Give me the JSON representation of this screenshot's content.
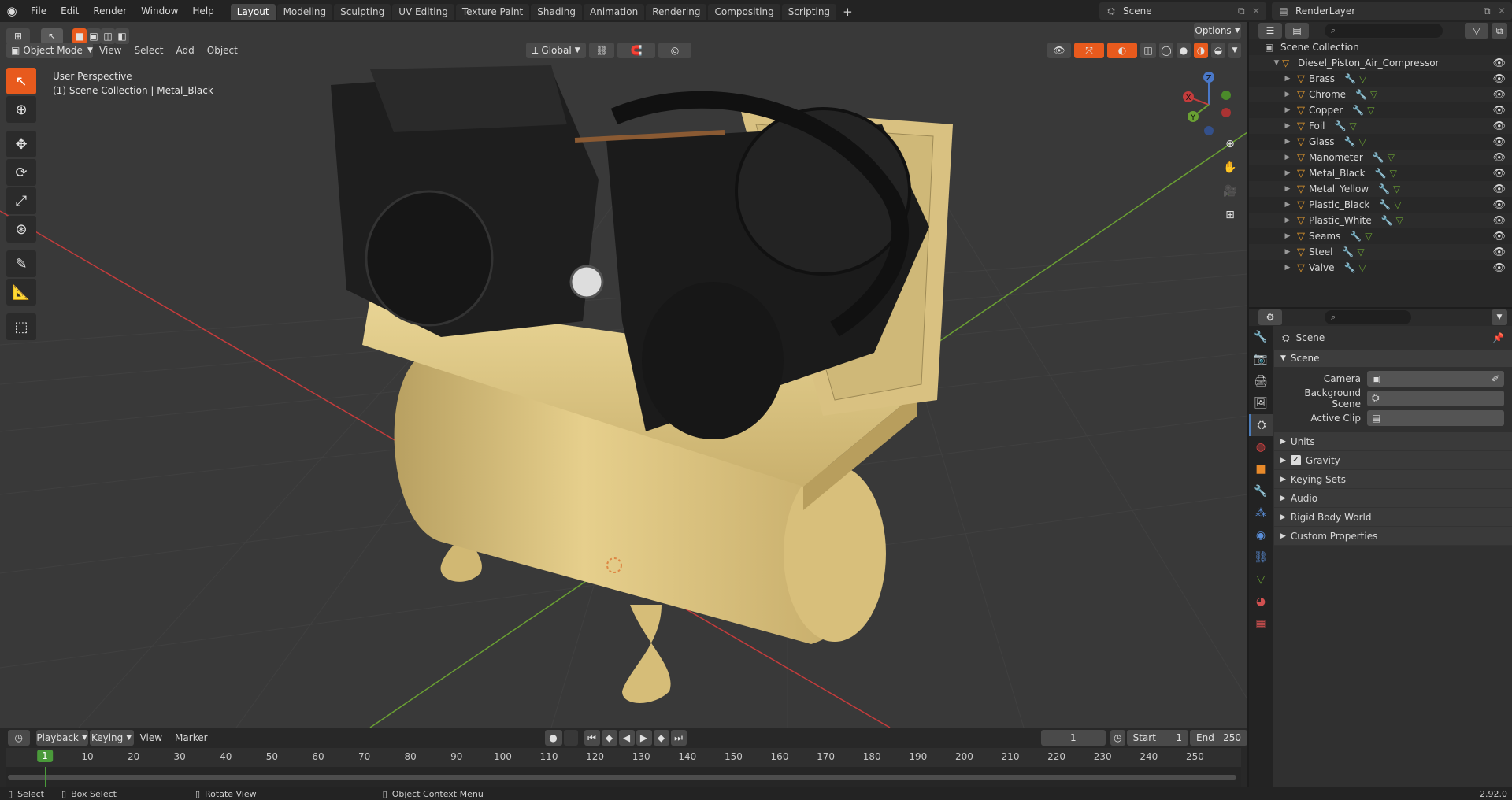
{
  "app": {
    "logo": "blender-icon"
  },
  "menu": [
    "File",
    "Edit",
    "Render",
    "Window",
    "Help"
  ],
  "workspaces": [
    {
      "label": "Layout",
      "active": true
    },
    {
      "label": "Modeling"
    },
    {
      "label": "Sculpting"
    },
    {
      "label": "UV Editing"
    },
    {
      "label": "Texture Paint"
    },
    {
      "label": "Shading"
    },
    {
      "label": "Animation"
    },
    {
      "label": "Rendering"
    },
    {
      "label": "Compositing"
    },
    {
      "label": "Scripting"
    }
  ],
  "workspace_add": "+",
  "scene_selector": {
    "value": "Scene"
  },
  "renderlayer_selector": {
    "value": "RenderLayer"
  },
  "viewport": {
    "mode": "Object Mode",
    "menus": [
      "View",
      "Select",
      "Add",
      "Object"
    ],
    "transform": "Global",
    "options_label": "Options",
    "perspective": "User Perspective",
    "collection_info": "(1) Scene Collection | Metal_Black",
    "gizmo_axes": {
      "x": "X",
      "y": "Y",
      "z": "Z"
    }
  },
  "timeline": {
    "menus": [
      "Playback",
      "Keying",
      "View",
      "Marker"
    ],
    "current_frame": "1",
    "start_label": "Start",
    "start": "1",
    "end_label": "End",
    "end": "250",
    "ruler": [
      "10",
      "20",
      "30",
      "40",
      "50",
      "60",
      "70",
      "80",
      "90",
      "100",
      "110",
      "120",
      "130",
      "140",
      "150",
      "160",
      "170",
      "180",
      "190",
      "200",
      "210",
      "220",
      "230",
      "240",
      "250"
    ],
    "playhead": "1"
  },
  "statusbar": {
    "select": "Select",
    "box_select": "Box Select",
    "rotate": "Rotate View",
    "context": "Object Context Menu",
    "version": "2.92.0"
  },
  "outliner": {
    "root": "Scene Collection",
    "object": "Diesel_Piston_Air_Compressor",
    "children": [
      "Brass",
      "Chrome",
      "Copper",
      "Foil",
      "Glass",
      "Manometer",
      "Metal_Black",
      "Metal_Yellow",
      "Plastic_Black",
      "Plastic_White",
      "Seams",
      "Steel",
      "Valve"
    ]
  },
  "properties": {
    "context_title": "Scene",
    "panel": "Scene",
    "fields": [
      {
        "label": "Camera",
        "value": ""
      },
      {
        "label": "Background Scene",
        "value": ""
      },
      {
        "label": "Active Clip",
        "value": ""
      }
    ],
    "subpanels": [
      {
        "label": "Units"
      },
      {
        "label": "Gravity",
        "checkbox": true
      },
      {
        "label": "Keying Sets"
      },
      {
        "label": "Audio"
      },
      {
        "label": "Rigid Body World"
      },
      {
        "label": "Custom Properties"
      }
    ]
  },
  "colors": {
    "accent": "#e85a1d",
    "tank": "#d9c07d",
    "machine": "#1e1e1e",
    "x_axis": "#c53c3c",
    "y_axis": "#6aa033"
  }
}
